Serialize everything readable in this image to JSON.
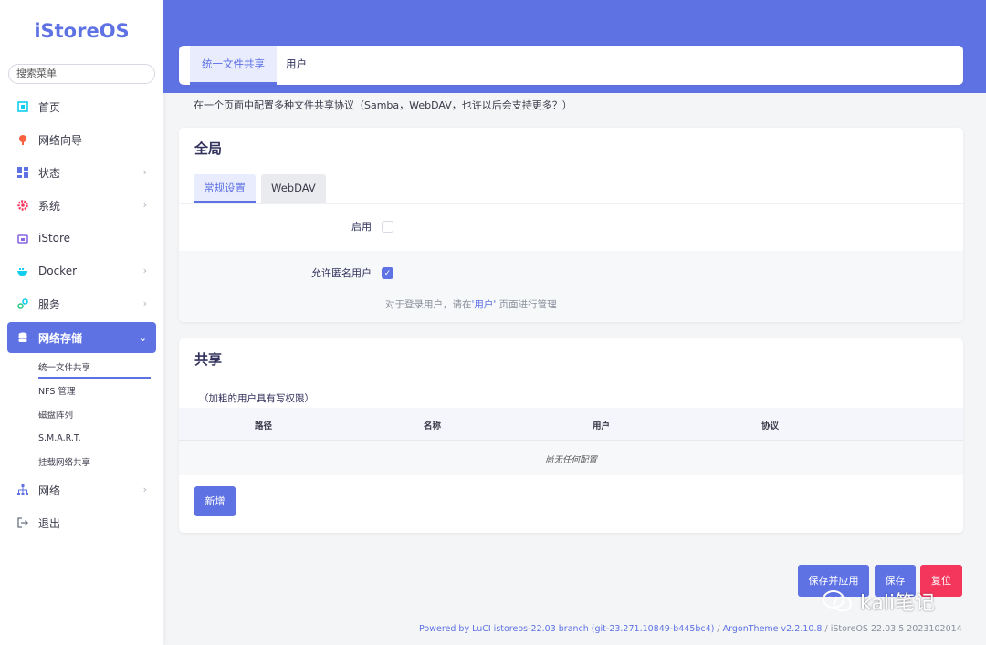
{
  "sidebar": {
    "logo": "iStoreOS",
    "search_placeholder": "搜索菜单",
    "items": [
      {
        "label": "首页",
        "icon": "home-icon"
      },
      {
        "label": "网络向导",
        "icon": "wizard-icon"
      },
      {
        "label": "状态",
        "icon": "dashboard-icon"
      },
      {
        "label": "系统",
        "icon": "gear-icon"
      },
      {
        "label": "iStore",
        "icon": "store-icon"
      },
      {
        "label": "Docker",
        "icon": "docker-icon"
      },
      {
        "label": "服务",
        "icon": "link-icon"
      },
      {
        "label": "网络存储",
        "icon": "database-icon"
      },
      {
        "label": "网络",
        "icon": "network-icon"
      },
      {
        "label": "退出",
        "icon": "logout-icon"
      }
    ],
    "subitems": [
      "统一文件共享",
      "NFS 管理",
      "磁盘阵列",
      "S.M.A.R.T.",
      "挂载网络共享"
    ]
  },
  "tabs": [
    "统一文件共享",
    "用户"
  ],
  "description": "在一个页面中配置多种文件共享协议（Samba，WebDAV，也许以后会支持更多？）",
  "global": {
    "title": "全局",
    "subtabs": [
      "常规设置",
      "WebDAV"
    ],
    "enable_label": "启用",
    "anon_label": "允许匿名用户",
    "hint_prefix": "对于登录用户，请在",
    "hint_link": "'用户'",
    "hint_suffix": "页面进行管理"
  },
  "share": {
    "title": "共享",
    "note": "（加粗的用户具有写权限）",
    "columns": [
      "路径",
      "名称",
      "用户",
      "协议"
    ],
    "empty_text": "尚无任何配置",
    "add_button": "新增"
  },
  "actions": {
    "save_apply": "保存并应用",
    "save": "保存",
    "reset": "复位"
  },
  "footer": {
    "powered": "Powered by LuCI istoreos-22.03 branch (git-23.271.10849-b445bc4)",
    "sep1": " / ",
    "theme": "ArgonTheme v2.2.10.8",
    "sep2": " / ",
    "version": "iStoreOS 22.03.5 2023102014"
  },
  "watermark": "kali笔记",
  "colors": {
    "accent": "#5e72e4",
    "danger": "#f5365c"
  }
}
